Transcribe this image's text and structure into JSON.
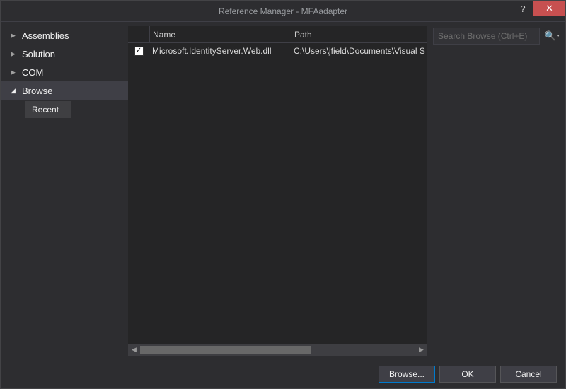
{
  "window": {
    "title": "Reference Manager - MFAadapter"
  },
  "sidebar": {
    "items": [
      {
        "label": "Assemblies",
        "expanded": false,
        "selected": false
      },
      {
        "label": "Solution",
        "expanded": false,
        "selected": false
      },
      {
        "label": "COM",
        "expanded": false,
        "selected": false
      },
      {
        "label": "Browse",
        "expanded": true,
        "selected": true
      }
    ],
    "sub": {
      "label": "Recent"
    }
  },
  "list": {
    "columns": {
      "name": "Name",
      "path": "Path"
    },
    "rows": [
      {
        "checked": true,
        "name": "Microsoft.IdentityServer.Web.dll",
        "path": "C:\\Users\\jfield\\Documents\\Visual S"
      }
    ]
  },
  "search": {
    "placeholder": "Search Browse (Ctrl+E)"
  },
  "footer": {
    "browse": "Browse...",
    "ok": "OK",
    "cancel": "Cancel"
  },
  "icons": {
    "check": "✓",
    "help": "?",
    "close": "✕",
    "search": "🔍",
    "right": "▶",
    "down": "◢",
    "caret": "▾",
    "scroll_left": "◀",
    "scroll_right": "▶"
  }
}
